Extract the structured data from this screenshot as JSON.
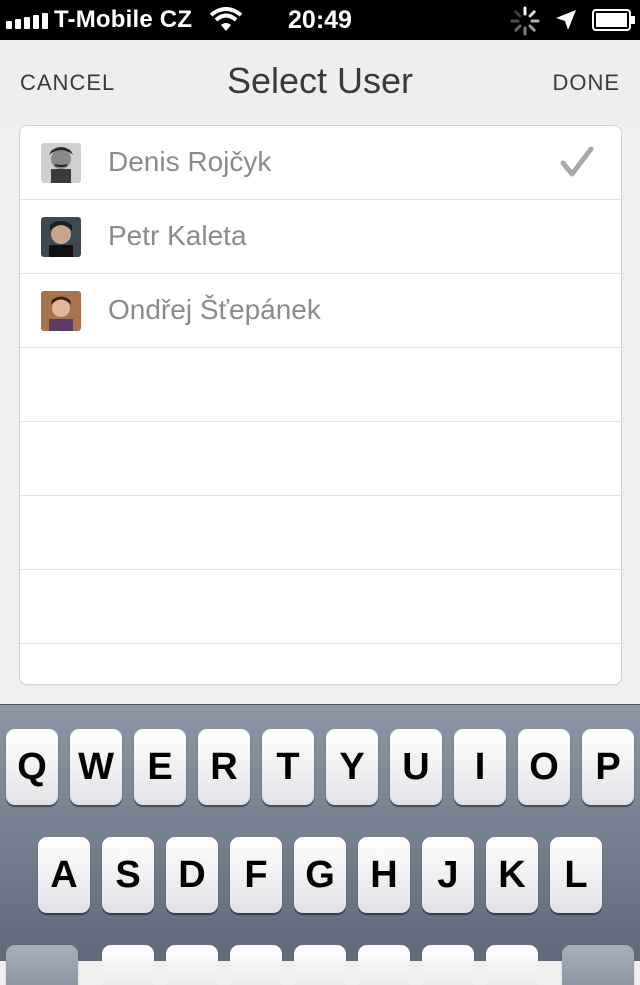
{
  "status_bar": {
    "carrier": "T-Mobile CZ",
    "time": "20:49",
    "icons": [
      "signal-icon",
      "wifi-icon",
      "activity-spinner-icon",
      "location-arrow-icon",
      "battery-icon"
    ]
  },
  "nav": {
    "cancel_label": "CANCEL",
    "title": "Select User",
    "done_label": "DONE"
  },
  "users": [
    {
      "name": "Denis Rojčyk",
      "selected": true
    },
    {
      "name": "Petr Kaleta",
      "selected": false
    },
    {
      "name": "Ondřej Šťepánek",
      "selected": false
    }
  ],
  "keyboard": {
    "row1": [
      "Q",
      "W",
      "E",
      "R",
      "T",
      "Y",
      "U",
      "I",
      "O",
      "P"
    ],
    "row2": [
      "A",
      "S",
      "D",
      "F",
      "G",
      "H",
      "J",
      "K",
      "L"
    ]
  },
  "colors": {
    "accent_text": "#3a3a3a",
    "name_text": "#8b8b8b",
    "checkmark": "#a9a9a9",
    "background": "#f0f0f0"
  }
}
